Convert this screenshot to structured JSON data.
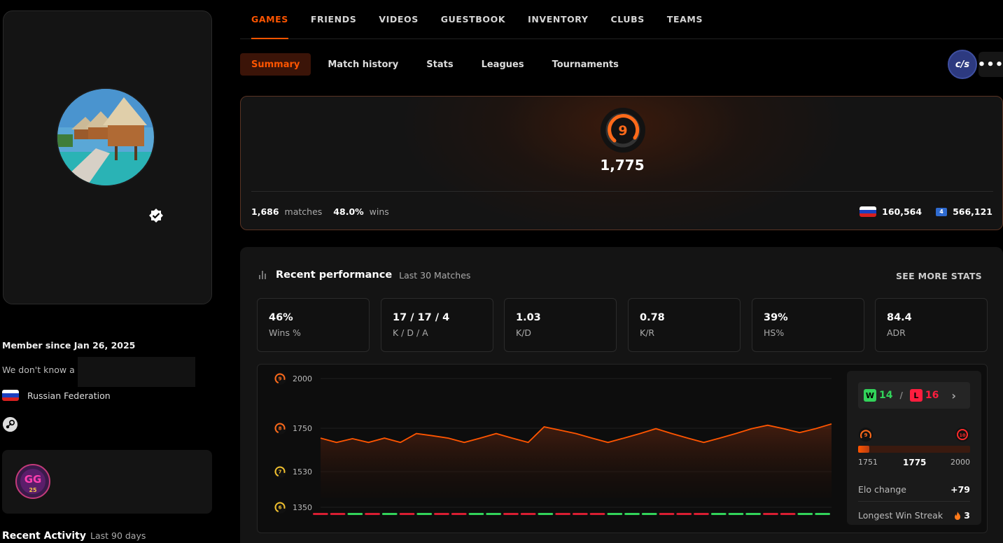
{
  "profile": {
    "member_since": "Member since Jan 26, 2025",
    "about": "We don't know a",
    "country": "Russian Federation",
    "recent_activity_title": "Recent Activity",
    "recent_activity_sub": "Last 90 days",
    "badge_text": "GG",
    "badge_num": "25"
  },
  "nav": {
    "tabs": [
      "GAMES",
      "FRIENDS",
      "VIDEOS",
      "GUESTBOOK",
      "INVENTORY",
      "CLUBS",
      "TEAMS"
    ],
    "active": "GAMES"
  },
  "subnav": {
    "tabs": [
      "Summary",
      "Match history",
      "Stats",
      "Leagues",
      "Tournaments"
    ],
    "active": "Summary",
    "game_logo": "c/s",
    "more": "•••"
  },
  "elo": {
    "level": "9",
    "value": "1,775",
    "matches": "1,686",
    "matches_label": "matches",
    "wins_pct": "48.0%",
    "wins_label": "wins",
    "country_rank": "160,564",
    "region_icon": "4",
    "region_rank": "566,121",
    "accent": "#ff5500"
  },
  "performance": {
    "title": "Recent performance",
    "subtitle": "Last 30 Matches",
    "see_more": "SEE MORE STATS",
    "stats": [
      {
        "value": "46%",
        "label": "Wins %"
      },
      {
        "value": "17 / 17 / 4",
        "label": "K / D / A"
      },
      {
        "value": "1.03",
        "label": "K/D"
      },
      {
        "value": "0.78",
        "label": "K/R"
      },
      {
        "value": "39%",
        "label": "HS%"
      },
      {
        "value": "84.4",
        "label": "ADR"
      }
    ],
    "side": {
      "w_letter": "W",
      "wins": "14",
      "slash": "/",
      "l_letter": "L",
      "losses": "16",
      "chevron": "›",
      "level_current": "9",
      "level_next": "10",
      "range_min": "1751",
      "range_current": "1775",
      "range_max": "2000",
      "progress_fraction": 0.1,
      "elo_change_label": "Elo change",
      "elo_change": "+79",
      "streak_label": "Longest Win Streak",
      "streak_icon": "fire-icon",
      "streak": "3"
    }
  },
  "chart_data": {
    "type": "area",
    "y_ticks": [
      {
        "level": "9",
        "value": 2000,
        "label": "2000"
      },
      {
        "level": "8",
        "value": 1750,
        "label": "1750"
      },
      {
        "level": "7",
        "value": 1530,
        "label": "1530"
      },
      {
        "level": "6",
        "value": 1350,
        "label": "1350"
      }
    ],
    "ylim": [
      1350,
      2000
    ],
    "series": [
      {
        "values": [
          1700,
          1678,
          1697,
          1678,
          1700,
          1678,
          1723,
          1712,
          1700,
          1678,
          1700,
          1723,
          1700,
          1678,
          1757,
          1740,
          1723,
          1700,
          1678,
          1700,
          1723,
          1748,
          1723,
          1700,
          1678,
          1700,
          1723,
          1748,
          1765,
          1748,
          1728,
          1748,
          1772
        ]
      }
    ],
    "results": [
      "L",
      "L",
      "W",
      "L",
      "W",
      "L",
      "W",
      "L",
      "L",
      "W",
      "W",
      "L",
      "L",
      "W",
      "L",
      "L",
      "L",
      "W",
      "W",
      "W",
      "L",
      "L",
      "L",
      "W",
      "W",
      "W",
      "L",
      "L",
      "W",
      "W"
    ],
    "colors": {
      "line": "#ff5500",
      "win": "#32d35a",
      "loss": "#d81e32"
    }
  }
}
